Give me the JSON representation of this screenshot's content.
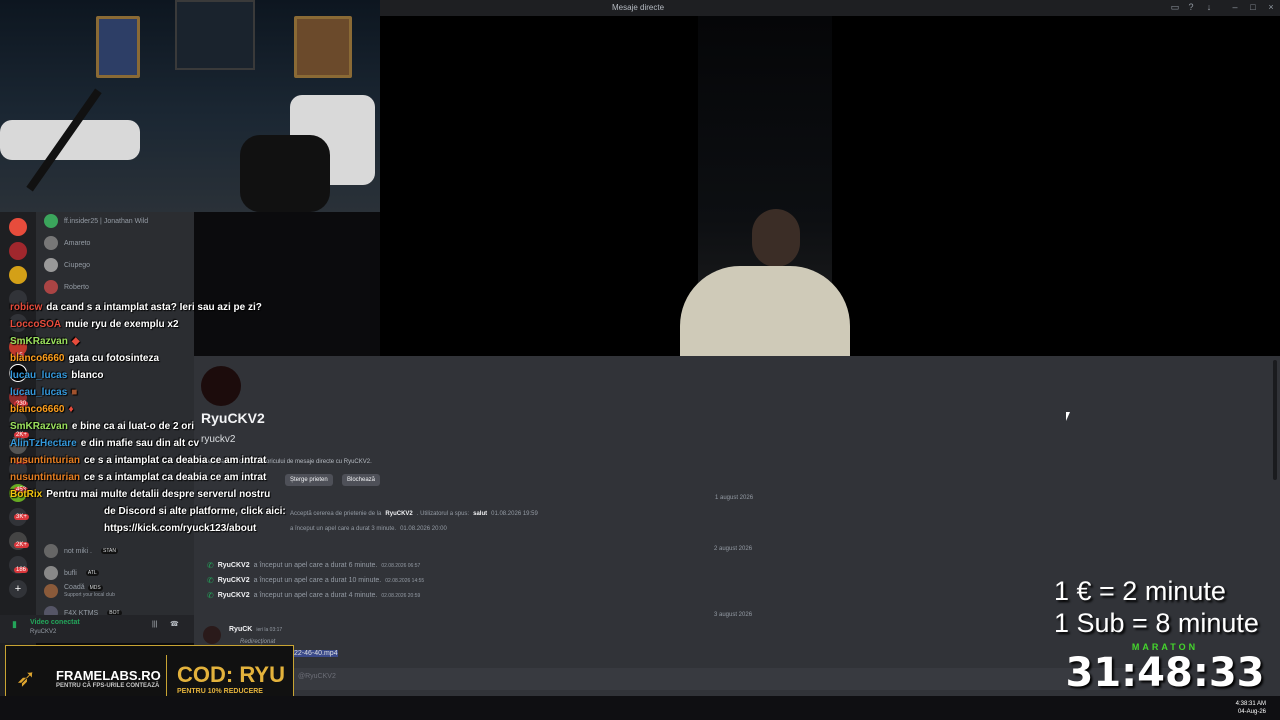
{
  "window": {
    "title": "Mesaje directe"
  },
  "dm_list": [
    {
      "name": "ff.insider25 | Jonathan Wild",
      "tag": ""
    },
    {
      "name": "Amareto",
      "tag": ""
    },
    {
      "name": "Ciupego",
      "tag": ""
    },
    {
      "name": "Roberto",
      "tag": ""
    },
    {
      "name": "not miki .",
      "tag": "STAN"
    },
    {
      "name": "bufli",
      "tag": "ATL"
    },
    {
      "name": "Coadă",
      "tag": "MDS",
      "sub": "Support your local club"
    },
    {
      "name": "F4X KTMS",
      "tag": "BOT"
    }
  ],
  "server_badges": [
    "15",
    "230",
    "2K+",
    "7K+",
    "453",
    "3K+",
    "2K+",
    "186"
  ],
  "voice": {
    "status": "Video conectat",
    "user": "RyuCKV2"
  },
  "profile": {
    "name": "RyuCKV2",
    "handle": "ryuckv2",
    "intro": "Acesta este începutul istoricului de mesaje directe cu RyuCKV2.",
    "remove_friend": "Șterge prieten",
    "block": "Blochează"
  },
  "messages": {
    "date1": "1 august 2026",
    "friend_text": "Acceptă cererea de prietenie de la",
    "friend_user": "RyuCKV2",
    "friend_said": ". Utilizatorul a spus:",
    "friend_msg": "salut",
    "friend_time": "01.08.2026 19:59",
    "call1": {
      "user": "RyuCKV2",
      "text": "a început un apel care a durat 3 minute.",
      "time": "01.08.2026 20:00"
    },
    "date2": "2 august 2026",
    "call2": {
      "user": "RyuCKV2",
      "text": "a început un apel care a durat 6 minute.",
      "time": "02.08.2026 06:57"
    },
    "call3": {
      "user": "RyuCKV2",
      "text": "a început un apel care a durat 10 minute.",
      "time": "02.08.2026 14:55"
    },
    "call4": {
      "user": "RyuCKV2",
      "text": "a început un apel care a durat 4 minute.",
      "time": "02.08.2026 20:59"
    },
    "date3": "3 august 2026",
    "last_user": "RyuCK",
    "last_time": "ieri la 03:17",
    "forwarded": "Redirecționat",
    "file": "22-46-40.mp4"
  },
  "composer": {
    "placeholder": "@RyuCKV2"
  },
  "chat": [
    {
      "user": "robicw",
      "text": "da cand s a intamplat asta? Ieri sau azi pe zi?",
      "color": "#e74c3c"
    },
    {
      "user": "LoccoSOA",
      "text": "muie ryu de exemplu x2",
      "color": "#e74c3c"
    },
    {
      "user": "SmKRazvan",
      "text": "",
      "color": "#9be15d"
    },
    {
      "user": "blanco6660",
      "text": "gata cu fotosinteza",
      "color": "#ff9f1c"
    },
    {
      "user": "lucau_lucas",
      "text": "blanco",
      "color": "#3498db"
    },
    {
      "user": "lucau_lucas",
      "text": "",
      "color": "#3498db"
    },
    {
      "user": "blanco6660",
      "text": "",
      "color": "#ff9f1c"
    },
    {
      "user": "SmKRazvan",
      "text": "e bine ca ai luat-o de 2 ori",
      "color": "#9be15d"
    },
    {
      "user": "AlinTzHectare",
      "text": "e din mafie sau din alt cv",
      "color": "#3498db"
    },
    {
      "user": "nusuntinturian",
      "text": "ce s a intamplat ca deabia ce am intrat",
      "color": "#e67e22"
    },
    {
      "user": "nusuntinturian",
      "text": "ce s a intamplat ca deabia ce am intrat",
      "color": "#e67e22"
    },
    {
      "user": "BotRix",
      "text": "Pentru mai multe detalii despre serverul nostru",
      "color": "#f1c40f"
    },
    {
      "user": "",
      "text": "de Discord si alte platforme, click aici:",
      "color": "#fff"
    },
    {
      "user": "",
      "text": "https://kick.com/ryuck123/about",
      "color": "#fff"
    }
  ],
  "banner": {
    "brand": "FRAMELABS.RO",
    "slogan": "PENTRU CĂ FPS-URILE CONTEAZĂ",
    "code": "COD: RYU",
    "discount": "PENTRU 10% REDUCERE"
  },
  "overlay": {
    "rate1": "1 € = 2 minute",
    "rate2": "1 Sub = 8 minute",
    "label": "MARATON",
    "timer": "31:48:33"
  },
  "clock": {
    "time": "4:38:31 AM",
    "date": "04-Aug-26"
  },
  "colors": {
    "discord_bg": "#313338",
    "sidebar": "#2b2d31",
    "accent": "#5865f2",
    "call_green": "#23a55a",
    "maraton_green": "#44d62c",
    "banner_gold": "#e3b23c"
  }
}
